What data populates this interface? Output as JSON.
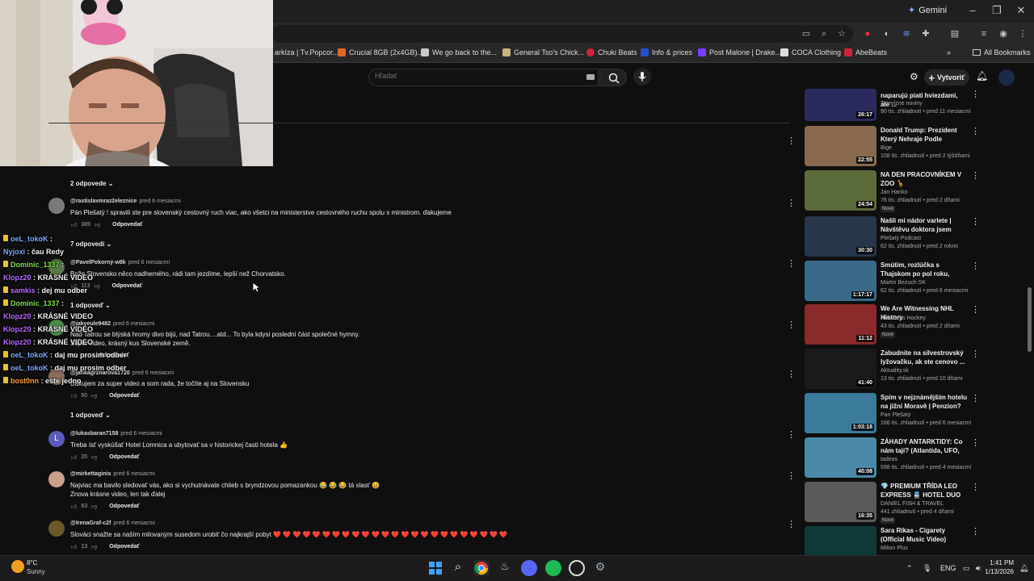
{
  "browser": {
    "gemini_label": "Gemini",
    "bookmarks": [
      {
        "label": "arkíza | Tv.Popcor...",
        "color": "#2b6cd6"
      },
      {
        "label": "Crucial 8GB (2x4GB)...",
        "color": "#e0662b"
      },
      {
        "label": "We go back to the...",
        "color": "#c9c9c9"
      },
      {
        "label": "General Tso's Chick...",
        "color": "#c8b27a"
      },
      {
        "label": "Chuki Beats",
        "color": "#d0233c"
      },
      {
        "label": "Info & prices",
        "color": "#2350c8"
      },
      {
        "label": "Post Malone | Drake...",
        "color": "#7a3cff"
      },
      {
        "label": "COCA Clothing",
        "color": "#dddddd"
      },
      {
        "label": "AbeBeats",
        "color": "#d0233c"
      }
    ],
    "all_bookmarks": "All Bookmarks"
  },
  "youtube": {
    "search_placeholder": "Hľadať",
    "create_label": "Vytvoriť"
  },
  "comments": [
    {
      "replies_label": "2 odpovede"
    },
    {
      "author": "@rastislavmrazželeznice",
      "time": "pred 6 mesiacmi",
      "text": "Pán Plešatý ! spravili ste pre slovenský cestovný ruch viac, ako všetci na ministerstve cestovného ruchu spolu s ministrom. ďakujeme",
      "likes": "389",
      "reply": "Odpovedať",
      "replies_label": "7 odpovedí"
    },
    {
      "author": "@PavelPokorný-w8k",
      "time": "pred 6 mesiacmi",
      "text": "Bože Slovensko něco nadherného, rádi tam jezdíme, lepší než Chorvatsko.",
      "likes": "113",
      "reply": "Odpovedať",
      "replies_label": "1 odpoveď"
    },
    {
      "author": "@jakyeule9482",
      "time": "pred 6 mesiacmi",
      "text1": "Nad Tatrou se blýská hromy divo bijú, nad Tatrou....atd... To byla kdysi poslední část společné hymny.",
      "text2": "Super video, krásný kus Slovenské země.",
      "likes": "",
      "reply": "Odpovedať"
    },
    {
      "author": "@jankagrznarova1720",
      "time": "pred 6 mesiacmi",
      "text": "Ďakujem za super video a som rada, že točíte aj na Slovensku",
      "likes": "50",
      "reply": "Odpovedať",
      "replies_label": "1 odpoveď"
    },
    {
      "author": "@lukasbaran7158",
      "time": "pred 6 mesiacmi",
      "text": "Treba ísť vyskúšať Hotel Lomnica a ubytovať sa v historickej časti hotela 👍",
      "likes": "20",
      "reply": "Odpovedať",
      "avatar_letter": "L"
    },
    {
      "author": "@mirkettaginis",
      "time": "pred 6 mesiacmi",
      "text1": "Najviac ma bavilo sledovať vás, ako si vychutnávate chlieb s bryndzovou pomazankou 😂 😂 😂 tá slasť 😄",
      "text2": "Znova krásne video, len tak ďalej",
      "likes": "63",
      "reply": "Odpovedať"
    },
    {
      "author": "@IrenaGraf-c2f",
      "time": "pred 6 mesiacmi",
      "text": "Slováci snažte sa naším milovaným susedom urobiť čo najkrajší pobyt ❤️ ❤️ ❤️ ❤️ ❤️ ❤️ ❤️ ❤️ ❤️ ❤️ ❤️ ❤️ ❤️ ❤️ ❤️ ❤️ ❤️ ❤️ ❤️ ❤️ ❤️ ❤️ ❤️ ❤️",
      "likes": "13",
      "reply": "Odpovedať"
    }
  ],
  "chat": [
    {
      "user": "oeL_tokoK",
      "msg": "",
      "color": "#7fa6ff"
    },
    {
      "user": "Nyjoxi",
      "msg": "čau Redy",
      "color": "#7fa6ff"
    },
    {
      "user": "Dominic_1337",
      "msg": "",
      "color": "#7cdc4c"
    },
    {
      "user": "Klopz20",
      "msg": "KRÁSNÉ VIDEO",
      "color": "#b769ff"
    },
    {
      "user": "samkis",
      "msg": "dej mu odber",
      "color": "#b769ff"
    },
    {
      "user": "Dominic_1337",
      "msg": "",
      "color": "#7cdc4c"
    },
    {
      "user": "Klopz20",
      "msg": "KRÁSNÉ VIDEO",
      "color": "#b769ff"
    },
    {
      "user": "Klopz20",
      "msg": "KRÁSNÉ VIDEO",
      "color": "#b769ff"
    },
    {
      "user": "Klopz20",
      "msg": "KRÁSNÉ VIDEO",
      "color": "#b769ff"
    },
    {
      "user": "oeL_tokoK",
      "msg": "daj mu prosim odber",
      "color": "#7fa6ff"
    },
    {
      "user": "oeL_tokoK",
      "msg": "daj mu prosim odber",
      "color": "#7fa6ff"
    },
    {
      "user": "bost0nn",
      "msg": "este jedno",
      "color": "#ff9a3c"
    }
  ],
  "sidebar": [
    {
      "title": "naparujú piati hviezdami, ale ...",
      "channel": "Televízne noviny",
      "meta": "90 tis. zhliadnutí • pred 11 mesiacmi",
      "duration": "26:17",
      "new": "",
      "color": "#2b2a5e"
    },
    {
      "title": "Donald Trump: Prezident Který Nehraje Podle Pravidel",
      "channel": "Bige",
      "meta": "108 tis. zhliadnutí • pred 2 týždňami",
      "duration": "22:55",
      "new": "",
      "color": "#8a6a4f"
    },
    {
      "title": "NA DEN PRACOVNÍKEM V ZOO 🦒",
      "channel": "Jan Hanko",
      "meta": "76 tis. zhliadnutí • pred 2 dňami",
      "duration": "24:54",
      "new": "Nové",
      "color": "#5c6b3a"
    },
    {
      "title": "Našli mi nádor varlete | Návštěvu doktora jsem odklád...",
      "channel": "Plešatý Podcast",
      "meta": "62 tis. zhliadnutí • pred 2 rokmi",
      "duration": "30:30",
      "new": "",
      "color": "#27364a"
    },
    {
      "title": "Smútim, rozlúčka s Thajskom po pol roku, menime krajinu | ...",
      "channel": "Martin Bezuch SK",
      "meta": "62 tis. zhliadnutí • pred 6 mesiacmi",
      "duration": "1:17:17",
      "new": "",
      "color": "#3a6a8a"
    },
    {
      "title": "We Are Witnessing NHL History",
      "channel": "Rob Talks Hockey",
      "meta": "43 tis. zhliadnutí • pred 2 dňami",
      "duration": "11:12",
      "new": "Nové",
      "color": "#8a2a2a"
    },
    {
      "title": "Zabudnite na silvestrovský lyžovačku, ak ste cenovo ...",
      "channel": "Aktuality.sk",
      "meta": "13 tis. zhliadnutí • pred 10 dňami",
      "duration": "41:40",
      "new": "",
      "color": "#1a1a1a"
    },
    {
      "title": "Spím v nejznámějším hotelu na jižní Moravě | Penzion? Spíš ...",
      "channel": "Pan Plešatý",
      "meta": "166 tis. zhliadnutí • pred 6 mesiacmi",
      "duration": "1:03:18",
      "new": "",
      "color": "#3a7a9a"
    },
    {
      "title": "ZÁHADY ANTARKTIDY: Co nám tají? (Atlantida, UFO, Vnitřní ...",
      "channel": "tadeas",
      "meta": "598 tis. zhliadnutí • pred 4 mesiacmi",
      "duration": "40:08",
      "new": "",
      "color": "#4a8aa8"
    },
    {
      "title": "💎 PREMIUM TŘÍDA LEO EXPRESS 🚆 HOTEL DUO ...",
      "channel": "DANIEL FISH & TRAVEL",
      "meta": "441 zhliadnutí • pred 4 dňami",
      "duration": "16:35",
      "new": "Nové",
      "color": "#5a5a5a"
    },
    {
      "title": "Sara Rikas - Cigarety (Official Music Video)",
      "channel": "Milion Plus",
      "meta": "",
      "duration": "",
      "new": "",
      "color": "#0f3a3a"
    }
  ],
  "taskbar": {
    "temp": "8°C",
    "weather": "Sunny",
    "lang": "ENG",
    "time": "1:41 PM",
    "date": "1/13/2026"
  }
}
